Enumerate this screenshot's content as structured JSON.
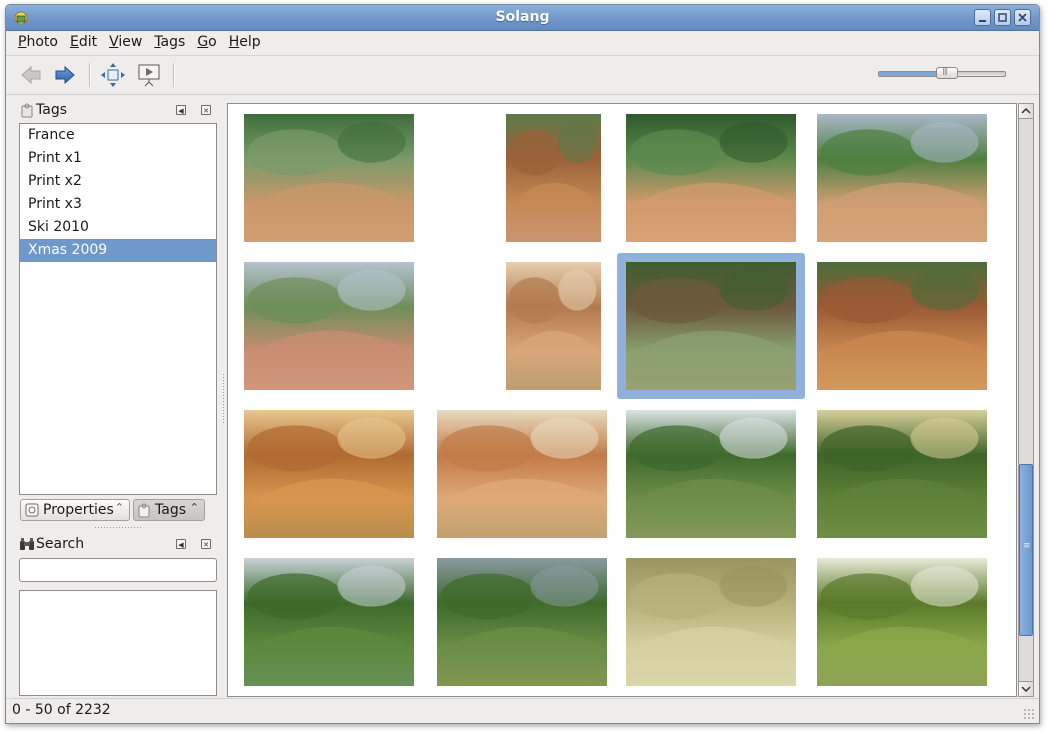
{
  "window": {
    "title": "Solang"
  },
  "menu": [
    {
      "label": "Photo",
      "u": "P",
      "rest": "hoto"
    },
    {
      "label": "Edit",
      "u": "E",
      "rest": "dit"
    },
    {
      "label": "View",
      "u": "V",
      "rest": "iew"
    },
    {
      "label": "Tags",
      "u": "T",
      "rest": "ags"
    },
    {
      "label": "Go",
      "u": "G",
      "rest": "o"
    },
    {
      "label": "Help",
      "u": "H",
      "rest": "elp"
    }
  ],
  "toolbar": {
    "buttons": [
      "back-icon",
      "forward-icon",
      "fit-window-icon",
      "slideshow-icon"
    ],
    "zoom_level": 0.55
  },
  "tags_pane": {
    "title": "Tags",
    "items": [
      "France",
      "Print x1",
      "Print x2",
      "Print x3",
      "Ski 2010",
      "Xmas 2009"
    ],
    "selected_index": 5,
    "tabs": [
      {
        "label": "Properties",
        "active": false
      },
      {
        "label": "Tags",
        "active": true
      }
    ]
  },
  "search_pane": {
    "title": "Search",
    "query": ""
  },
  "thumbnails": {
    "selected_index": 6,
    "items": [
      {
        "orient": "landscape",
        "palette": [
          "#7a9a6a",
          "#c9976a",
          "#e2b88a",
          "#3f6e3a"
        ]
      },
      {
        "orient": "portrait",
        "palette": [
          "#9a6238",
          "#c48a56",
          "#d9b7c9",
          "#5b7a4a"
        ]
      },
      {
        "orient": "landscape",
        "palette": [
          "#5d8a4e",
          "#d29a6c",
          "#e8c098",
          "#2f5a2c"
        ]
      },
      {
        "orient": "landscape",
        "palette": [
          "#4e7f40",
          "#cf9e72",
          "#e6b88c",
          "#aab8c8"
        ]
      },
      {
        "orient": "landscape",
        "palette": [
          "#6e8e5a",
          "#c98d72",
          "#dbb39a",
          "#b5c3cf"
        ]
      },
      {
        "orient": "portrait",
        "palette": [
          "#b27a4e",
          "#d8a67a",
          "#6b8a5a",
          "#e8cfb0"
        ]
      },
      {
        "orient": "landscape",
        "palette": [
          "#6b5a3c",
          "#8aa070",
          "#c7a27a",
          "#3e5e30"
        ]
      },
      {
        "orient": "landscape",
        "palette": [
          "#9a5a34",
          "#c98850",
          "#e5d27a",
          "#4a6e3a"
        ]
      },
      {
        "orient": "landscape",
        "palette": [
          "#b06a30",
          "#d89550",
          "#5a7a40",
          "#e8c890"
        ]
      },
      {
        "orient": "landscape",
        "palette": [
          "#c27a48",
          "#deaa78",
          "#6e8a52",
          "#e8dcc0"
        ]
      },
      {
        "orient": "landscape",
        "palette": [
          "#3f6a2c",
          "#6e8e4a",
          "#c9b690",
          "#dbe2e6"
        ]
      },
      {
        "orient": "landscape",
        "palette": [
          "#3e6428",
          "#5e8238",
          "#a9b468",
          "#d8ce98"
        ]
      },
      {
        "orient": "landscape",
        "palette": [
          "#3d6a2a",
          "#5c8a3e",
          "#8aa0a8",
          "#c8d2d8"
        ]
      },
      {
        "orient": "landscape",
        "palette": [
          "#3e6a2a",
          "#6a8e46",
          "#c9b07c",
          "#8a9aa2"
        ]
      },
      {
        "orient": "landscape",
        "palette": [
          "#b8b07a",
          "#d6d0a0",
          "#e8e4c8",
          "#9a9460"
        ]
      },
      {
        "orient": "landscape",
        "palette": [
          "#5a7a2a",
          "#8aa84a",
          "#a09078",
          "#e8ead8"
        ]
      }
    ]
  },
  "status": {
    "text": "0 - 50 of 2232"
  },
  "colors": {
    "accent": "#6f98cb",
    "selection_frame": "#8fb1dc",
    "title_bar": "#6f97c9"
  }
}
